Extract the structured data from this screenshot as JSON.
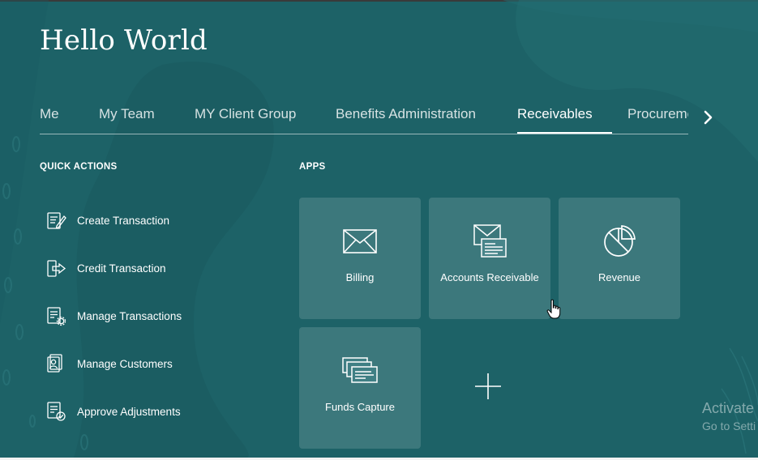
{
  "page": {
    "title": "Hello World"
  },
  "tabs": [
    {
      "label": "Me",
      "active": false
    },
    {
      "label": "My Team",
      "active": false
    },
    {
      "label": "MY Client Group",
      "active": false
    },
    {
      "label": "Benefits Administration",
      "active": false
    },
    {
      "label": "Receivables",
      "active": true
    },
    {
      "label": "Procurement",
      "active": false
    }
  ],
  "quick_actions": {
    "heading": "QUICK ACTIONS",
    "items": [
      {
        "label": "Create Transaction",
        "icon": "create-transaction-icon"
      },
      {
        "label": "Credit Transaction",
        "icon": "credit-transaction-icon"
      },
      {
        "label": "Manage Transactions",
        "icon": "manage-transactions-icon"
      },
      {
        "label": "Manage Customers",
        "icon": "manage-customers-icon"
      },
      {
        "label": "Approve Adjustments",
        "icon": "approve-adjustments-icon"
      }
    ]
  },
  "apps": {
    "heading": "APPS",
    "tiles": [
      {
        "label": "Billing",
        "icon": "envelope-icon"
      },
      {
        "label": "Accounts Receivable",
        "icon": "envelope-document-icon"
      },
      {
        "label": "Revenue",
        "icon": "pie-chart-icon"
      },
      {
        "label": "Funds Capture",
        "icon": "checks-stack-icon"
      }
    ],
    "add_icon": "plus-icon"
  },
  "watermark": {
    "line1": "Activate",
    "line2": "Go to Setti"
  },
  "colors": {
    "background": "#1d6267",
    "tile": "rgba(255,255,255,0.14)",
    "text": "#ffffff"
  }
}
